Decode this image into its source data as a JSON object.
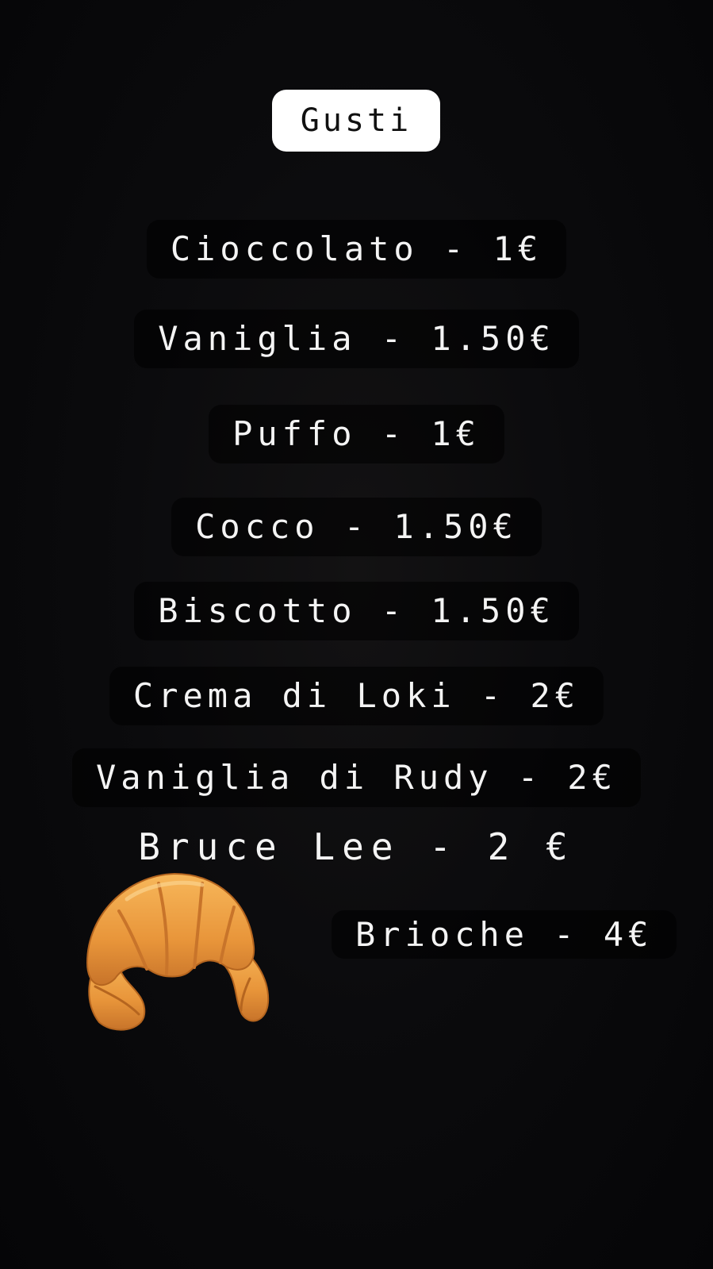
{
  "title": "Gusti",
  "items": [
    {
      "label": "Cioccolato - 1€"
    },
    {
      "label": "Vaniglia - 1.50€"
    },
    {
      "label": "Puffo - 1€"
    },
    {
      "label": "Cocco - 1.50€"
    },
    {
      "label": "Biscotto - 1.50€"
    },
    {
      "label": "Crema di Loki - 2€"
    },
    {
      "label": "Vaniglia di Rudy - 2€"
    },
    {
      "label": "Bruce Lee - 2 €"
    },
    {
      "label": "Brioche - 4€"
    }
  ],
  "icons": {
    "croissant": "croissant-icon"
  },
  "colors": {
    "background": "#07070a",
    "pill": "#ffffff",
    "text": "#f4f4f4",
    "croissant": "#e89a3c"
  }
}
